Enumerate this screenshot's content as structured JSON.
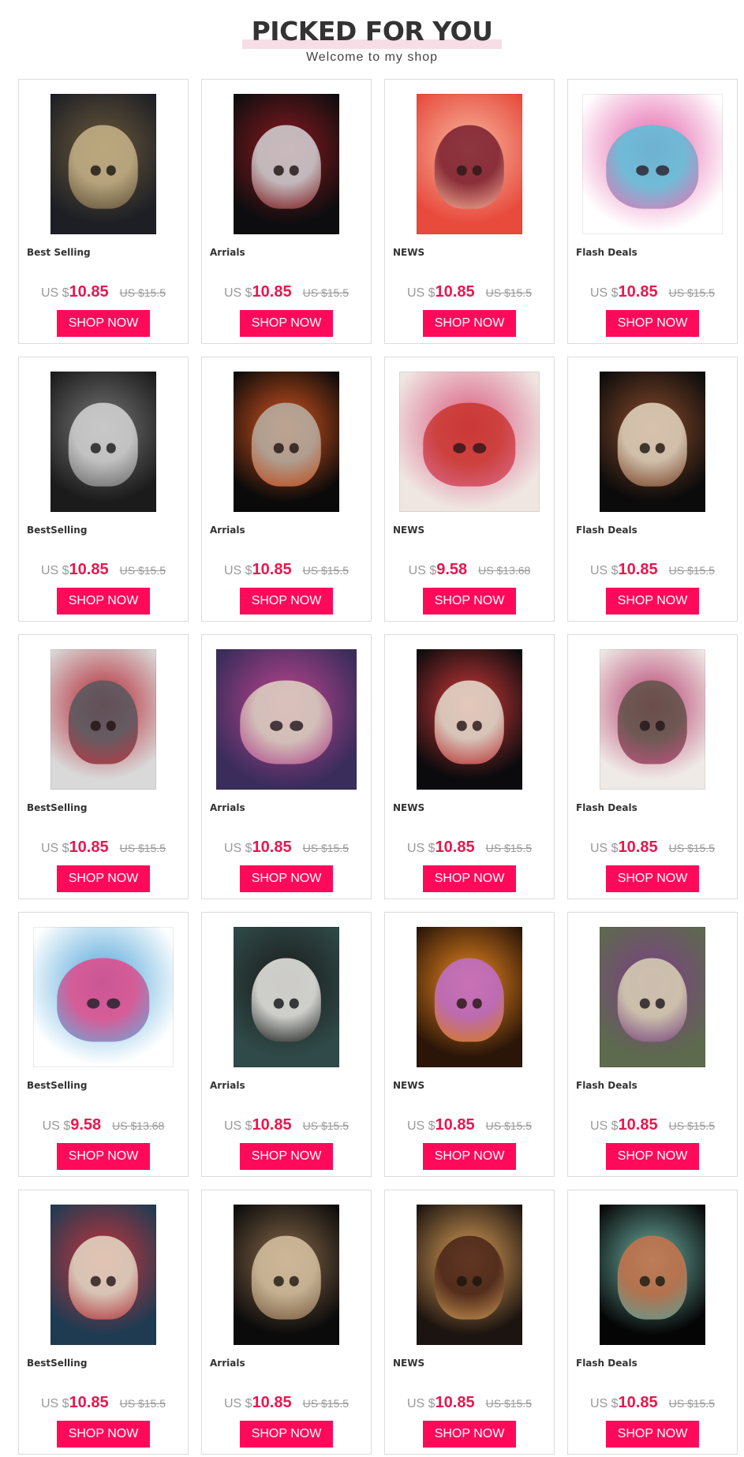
{
  "header": {
    "title": "PICKED FOR YOU",
    "subtitle": "Welcome to my shop"
  },
  "products": [
    {
      "label": "Best Selling",
      "currency": "US $",
      "price": "10.85",
      "old_price": "US $15.5",
      "button": "SHOP NOW",
      "shape": "portrait",
      "colors": [
        "#1d1f25",
        "#6c5a3b",
        "#c9b58a"
      ]
    },
    {
      "label": "Arrials",
      "currency": "US $",
      "price": "10.85",
      "old_price": "US $15.5",
      "button": "SHOP NOW",
      "shape": "portrait",
      "colors": [
        "#0d0d0f",
        "#8e1a1f",
        "#d5d5d8"
      ]
    },
    {
      "label": "NEWS",
      "currency": "US $",
      "price": "10.85",
      "old_price": "US $15.5",
      "button": "SHOP NOW",
      "shape": "portrait",
      "colors": [
        "#e84a3c",
        "#f6b9a0",
        "#7a2030"
      ]
    },
    {
      "label": "Flash Deals",
      "currency": "US $",
      "price": "10.85",
      "old_price": "US $15.5",
      "button": "SHOP NOW",
      "shape": "wide",
      "colors": [
        "#ffffff",
        "#e45ea8",
        "#5bc0d9"
      ]
    },
    {
      "label": "BestSelling",
      "currency": "US $",
      "price": "10.85",
      "old_price": "US $15.5",
      "button": "SHOP NOW",
      "shape": "portrait",
      "colors": [
        "#1b1b1b",
        "#777777",
        "#d6d6d6"
      ]
    },
    {
      "label": "Arrials",
      "currency": "US $",
      "price": "10.85",
      "old_price": "US $15.5",
      "button": "SHOP NOW",
      "shape": "portrait",
      "colors": [
        "#0a0a0a",
        "#d9561f",
        "#b9b1a6"
      ]
    },
    {
      "label": "NEWS",
      "currency": "US $",
      "price": "9.58",
      "old_price": "US $13.68",
      "button": "SHOP NOW",
      "shape": "wide",
      "colors": [
        "#efe6e2",
        "#d9557c",
        "#c9342c"
      ]
    },
    {
      "label": "Flash Deals",
      "currency": "US $",
      "price": "10.85",
      "old_price": "US $15.5",
      "button": "SHOP NOW",
      "shape": "portrait",
      "colors": [
        "#0b0b0b",
        "#8a4b2c",
        "#e6d8c3"
      ]
    },
    {
      "label": "BestSelling",
      "currency": "US $",
      "price": "10.85",
      "old_price": "US $15.5",
      "button": "SHOP NOW",
      "shape": "portrait",
      "colors": [
        "#d9d9d9",
        "#b3212d",
        "#55585e"
      ]
    },
    {
      "label": "Arrials",
      "currency": "US $",
      "price": "10.85",
      "old_price": "US $15.5",
      "button": "SHOP NOW",
      "shape": "wide",
      "colors": [
        "#3a2d5c",
        "#c0448e",
        "#e0d6c4"
      ]
    },
    {
      "label": "NEWS",
      "currency": "US $",
      "price": "10.85",
      "old_price": "US $15.5",
      "button": "SHOP NOW",
      "shape": "portrait",
      "colors": [
        "#0b0b0d",
        "#d23a3a",
        "#e8e0d2"
      ]
    },
    {
      "label": "Flash Deals",
      "currency": "US $",
      "price": "10.85",
      "old_price": "US $15.5",
      "button": "SHOP NOW",
      "shape": "portrait",
      "colors": [
        "#efeae6",
        "#b53d6d",
        "#5e5147"
      ]
    },
    {
      "label": "BestSelling",
      "currency": "US $",
      "price": "9.58",
      "old_price": "US $13.68",
      "button": "SHOP NOW",
      "shape": "wide",
      "colors": [
        "#ffffff",
        "#4aa3d8",
        "#e14a8a"
      ]
    },
    {
      "label": "Arrials",
      "currency": "US $",
      "price": "10.85",
      "old_price": "US $15.5",
      "button": "SHOP NOW",
      "shape": "portrait",
      "colors": [
        "#2f4a48",
        "#1a1a1a",
        "#ecebe6"
      ]
    },
    {
      "label": "NEWS",
      "currency": "US $",
      "price": "10.85",
      "old_price": "US $15.5",
      "button": "SHOP NOW",
      "shape": "portrait",
      "colors": [
        "#2a1508",
        "#f08a1f",
        "#c36fcf"
      ]
    },
    {
      "label": "Flash Deals",
      "currency": "US $",
      "price": "10.85",
      "old_price": "US $15.5",
      "button": "SHOP NOW",
      "shape": "portrait",
      "colors": [
        "#5d6a4e",
        "#7d3f86",
        "#dcd3b7"
      ]
    },
    {
      "label": "BestSelling",
      "currency": "US $",
      "price": "10.85",
      "old_price": "US $15.5",
      "button": "SHOP NOW",
      "shape": "portrait",
      "colors": [
        "#1e3b52",
        "#c8343a",
        "#e7dcc8"
      ]
    },
    {
      "label": "Arrials",
      "currency": "US $",
      "price": "10.85",
      "old_price": "US $15.5",
      "button": "SHOP NOW",
      "shape": "portrait",
      "colors": [
        "#0b0b0b",
        "#8a6a4a",
        "#d9c4a4"
      ]
    },
    {
      "label": "NEWS",
      "currency": "US $",
      "price": "10.85",
      "old_price": "US $15.5",
      "button": "SHOP NOW",
      "shape": "portrait",
      "colors": [
        "#1c1410",
        "#e0a35a",
        "#4a2418"
      ]
    },
    {
      "label": "Flash Deals",
      "currency": "US $",
      "price": "10.85",
      "old_price": "US $15.5",
      "button": "SHOP NOW",
      "shape": "portrait",
      "colors": [
        "#050505",
        "#6fb3a7",
        "#c9744b"
      ]
    }
  ]
}
